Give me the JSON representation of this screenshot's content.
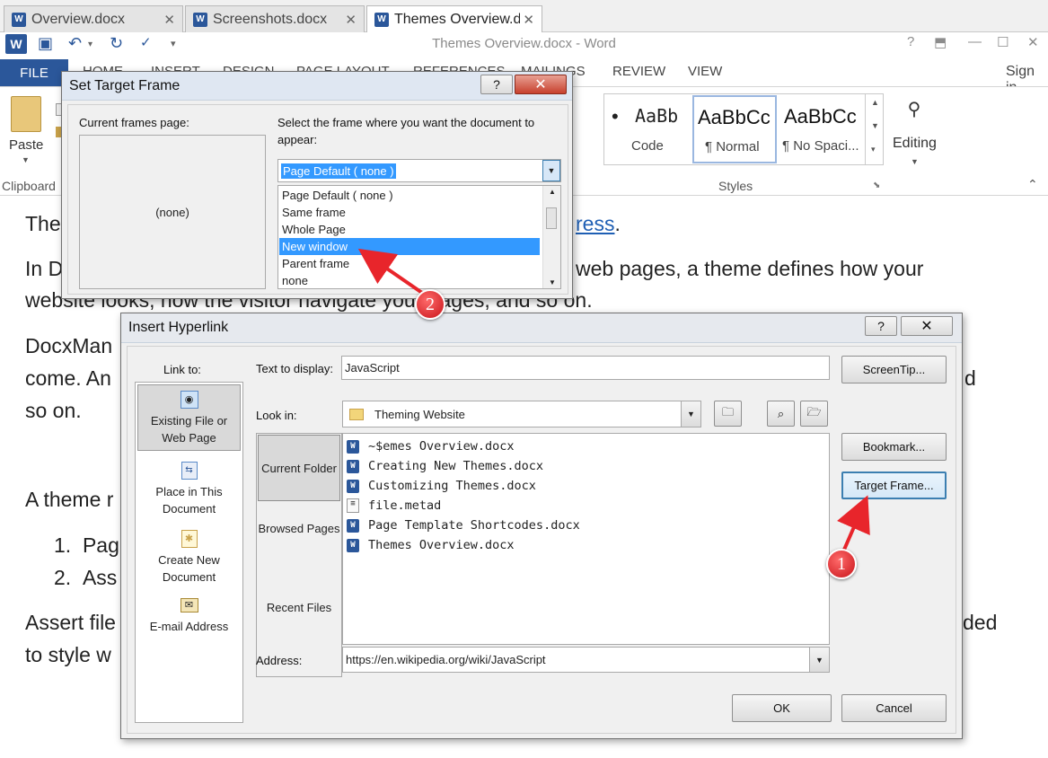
{
  "tabs": [
    {
      "label": "Overview.docx"
    },
    {
      "label": "Screenshots.docx"
    },
    {
      "label": "Themes Overview.do"
    }
  ],
  "window": {
    "title": "Themes Overview.docx - Word",
    "help": "?"
  },
  "ribbon": {
    "file": "FILE",
    "tabs": [
      "HOME",
      "INSERT",
      "DESIGN",
      "PAGE LAYOUT",
      "REFERENCES",
      "MAILINGS",
      "REVIEW",
      "VIEW"
    ],
    "sign_in": "Sign in",
    "paste": "Paste",
    "clipboard": "Clipboard",
    "styles": {
      "label": "Styles",
      "items": [
        {
          "sample": "AaBb",
          "name": "Code"
        },
        {
          "sample": "AaBbCc",
          "name": "¶ Normal"
        },
        {
          "sample": "AaBbCc",
          "name": "¶ No Spaci..."
        }
      ]
    },
    "editing": "Editing"
  },
  "document": {
    "line1_start": "The",
    "line1_link": "ress",
    "line1_end": ".",
    "line2_start": "In D",
    "line2_end": "web pages, a theme defines how your",
    "line3": "website looks, how the visitor navigate your pages, and so on.",
    "line4": "DocxMan",
    "line5_start": "come. An",
    "line5_end": "d",
    "line6": "so on.",
    "line7": "A theme r",
    "list": [
      {
        "num": "1.",
        "text": "Pag"
      },
      {
        "num": "2.",
        "text": "Ass"
      }
    ],
    "line8_start": "Assert file",
    "line8_end": "ded",
    "line9": "to style w"
  },
  "target_frame": {
    "title": "Set Target Frame",
    "help": "?",
    "current_label": "Current frames page:",
    "none": "(none)",
    "select_label_1": "Select the frame where you want the document to",
    "select_label_2": "appear:",
    "selected": "Page Default ( none )",
    "options": [
      "Page Default ( none )",
      "Same frame",
      "Whole Page",
      "New window",
      "Parent frame",
      "none"
    ],
    "highlighted": "New window"
  },
  "hyperlink": {
    "title": "Insert Hyperlink",
    "help": "?",
    "link_to": "Link to:",
    "link_options": [
      {
        "label": "Existing File or Web Page",
        "icon": "web-page-icon"
      },
      {
        "label": "Place in This Document",
        "icon": "document-place-icon"
      },
      {
        "label": "Create New Document",
        "icon": "new-document-icon"
      },
      {
        "label": "E-mail Address",
        "icon": "email-icon"
      }
    ],
    "text_label": "Text to display:",
    "text_value": "JavaScript",
    "screentip": "ScreenTip...",
    "lookin_label": "Look in:",
    "lookin_value": "Theming Website",
    "sources": [
      "Current Folder",
      "Browsed Pages",
      "Recent Files"
    ],
    "files": [
      "~$emes Overview.docx",
      "Creating New Themes.docx",
      "Customizing Themes.docx",
      "file.metad",
      "Page Template Shortcodes.docx",
      "Themes Overview.docx"
    ],
    "bookmark": "Bookmark...",
    "target_frame": "Target Frame...",
    "address_label": "Address:",
    "address_value": "https://en.wikipedia.org/wiki/JavaScript",
    "ok": "OK",
    "cancel": "Cancel"
  },
  "annotations": [
    "1",
    "2"
  ]
}
